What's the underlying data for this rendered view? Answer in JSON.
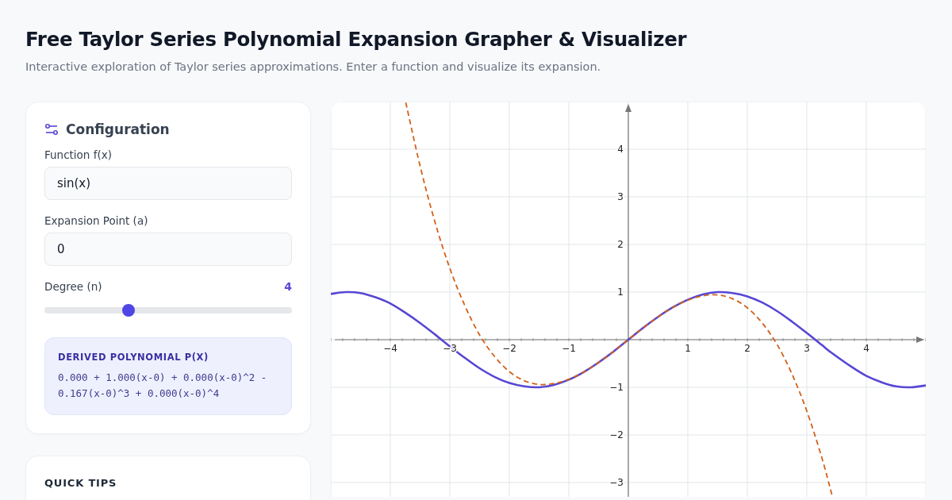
{
  "header": {
    "title": "Free Taylor Series Polynomial Expansion Grapher & Visualizer",
    "subtitle": "Interactive exploration of Taylor series approximations. Enter a function and visualize its expansion."
  },
  "config": {
    "title": "Configuration",
    "fields": [
      {
        "kind": "text",
        "label": "Function f(x)",
        "value": "sin(x)"
      },
      {
        "kind": "text",
        "label": "Expansion Point (a)",
        "value": "0"
      },
      {
        "kind": "slider",
        "label": "Degree (n)",
        "value": "4",
        "level": 0.34
      }
    ],
    "polynomial": {
      "title": "DERIVED POLYNOMIAL P(X)",
      "text": "0.000 + 1.000(x-0) + 0.000(x-0)^2 - 0.167(x-0)^3 + 0.000(x-0)^4"
    }
  },
  "tips": {
    "title": "QUICK TIPS"
  },
  "graph": {
    "chart_data": {
      "type": "line",
      "grid": true,
      "x": [
        -5,
        -4.75,
        -4.5,
        -4.25,
        -4,
        -3.74,
        -3.5,
        -3.25,
        -3,
        -2.75,
        -2.5,
        -2.25,
        -2,
        -1.75,
        -1.5,
        -1.25,
        -1,
        -0.75,
        -0.5,
        -0.25,
        0,
        0.25,
        0.5,
        0.75,
        1,
        1.25,
        1.5,
        1.75,
        2,
        2.25,
        2.5,
        2.75,
        3,
        3.25,
        3.42,
        3.75,
        4,
        4.25,
        4.5,
        4.75,
        5
      ],
      "series": [
        {
          "color": "#5647d4",
          "line_style": "solid",
          "values": [
            0.96,
            1.0,
            0.98,
            0.89,
            0.76,
            0.56,
            0.35,
            0.11,
            -0.14,
            -0.38,
            -0.6,
            -0.78,
            -0.91,
            -0.98,
            -1.0,
            -0.95,
            -0.84,
            -0.68,
            -0.48,
            -0.25,
            0,
            0.25,
            0.48,
            0.68,
            0.84,
            0.95,
            1.0,
            0.98,
            0.91,
            0.78,
            0.6,
            0.38,
            0.14,
            -0.11,
            -0.28,
            -0.57,
            -0.76,
            -0.89,
            -0.98,
            -1.0,
            -0.96
          ]
        },
        {
          "color": "#d2601a",
          "line_style": "dashed",
          "values": [
            null,
            null,
            null,
            null,
            null,
            4.98,
            3.65,
            2.47,
            1.5,
            0.72,
            0.1,
            -0.35,
            -0.67,
            -0.86,
            -0.94,
            -0.92,
            -0.83,
            -0.68,
            -0.48,
            -0.25,
            0,
            0.25,
            0.48,
            0.68,
            0.83,
            0.92,
            0.94,
            0.86,
            0.67,
            0.35,
            -0.1,
            -0.72,
            -1.5,
            -2.47,
            -3.25,
            null,
            null,
            null,
            null,
            null,
            null
          ]
        }
      ],
      "xlim": [
        -5,
        5
      ],
      "ylim": [
        -3.3,
        5
      ],
      "xticks": [
        {
          "value": -4,
          "label": "−4"
        },
        {
          "value": -3,
          "label": "−3"
        },
        {
          "value": -2,
          "label": "−2"
        },
        {
          "value": -1,
          "label": "−1"
        },
        1,
        2,
        3,
        4
      ],
      "yticks": [
        4,
        3,
        2,
        1,
        {
          "value": -1,
          "label": "−1"
        },
        {
          "value": -2,
          "label": "−2"
        },
        {
          "value": -3,
          "label": "−3"
        }
      ]
    }
  }
}
